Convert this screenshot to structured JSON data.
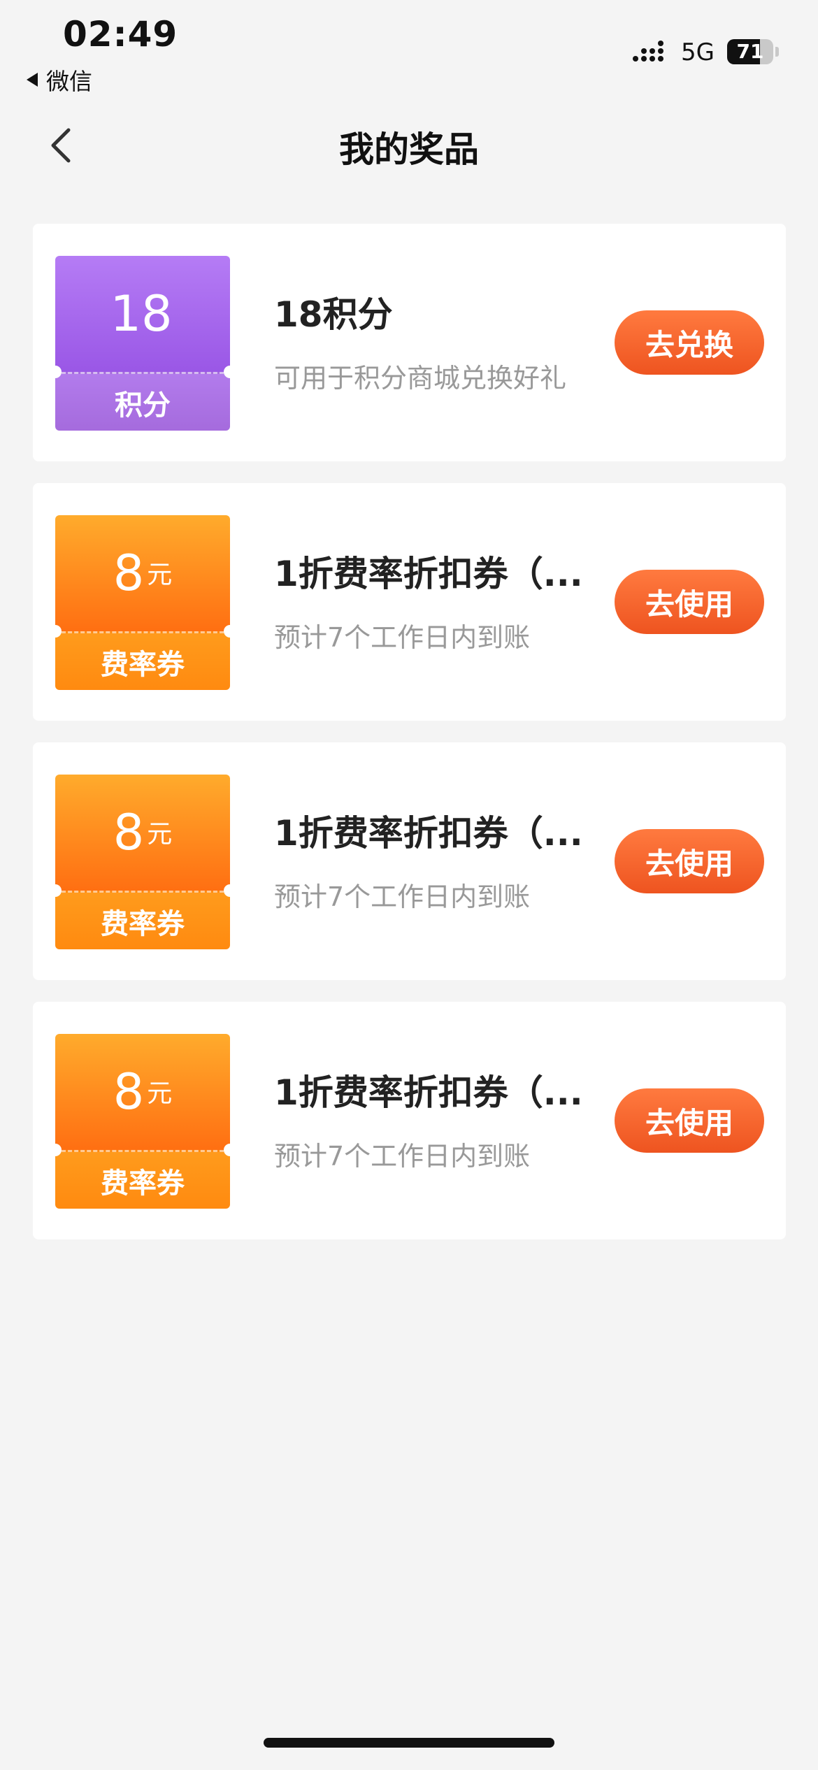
{
  "status_bar": {
    "time": "02:49",
    "back_app": "微信",
    "network": "5G",
    "battery_level": "71",
    "battery_fraction": 0.71
  },
  "nav": {
    "back_icon": "chevron-left-icon",
    "title": "我的奖品"
  },
  "prizes": [
    {
      "amount": "18",
      "unit": "",
      "ticket_label": "积分",
      "ticket_color": "purple",
      "title": "18积分",
      "subtitle": "可用于积分商城兑换好礼",
      "action": "去兑换"
    },
    {
      "amount": "8",
      "unit": "元",
      "ticket_label": "费率券",
      "ticket_color": "orange",
      "title": "1折费率折扣券（...",
      "subtitle": "预计7个工作日内到账",
      "action": "去使用"
    },
    {
      "amount": "8",
      "unit": "元",
      "ticket_label": "费率券",
      "ticket_color": "orange",
      "title": "1折费率折扣券（...",
      "subtitle": "预计7个工作日内到账",
      "action": "去使用"
    },
    {
      "amount": "8",
      "unit": "元",
      "ticket_label": "费率券",
      "ticket_color": "orange",
      "title": "1折费率折扣券（...",
      "subtitle": "预计7个工作日内到账",
      "action": "去使用"
    }
  ],
  "colors": {
    "background": "#f4f4f4",
    "button_gradient_top": "#ff7a3f",
    "button_gradient_bottom": "#ee5420",
    "purple_ticket": "#a866e8",
    "orange_ticket": "#ff8a10"
  }
}
